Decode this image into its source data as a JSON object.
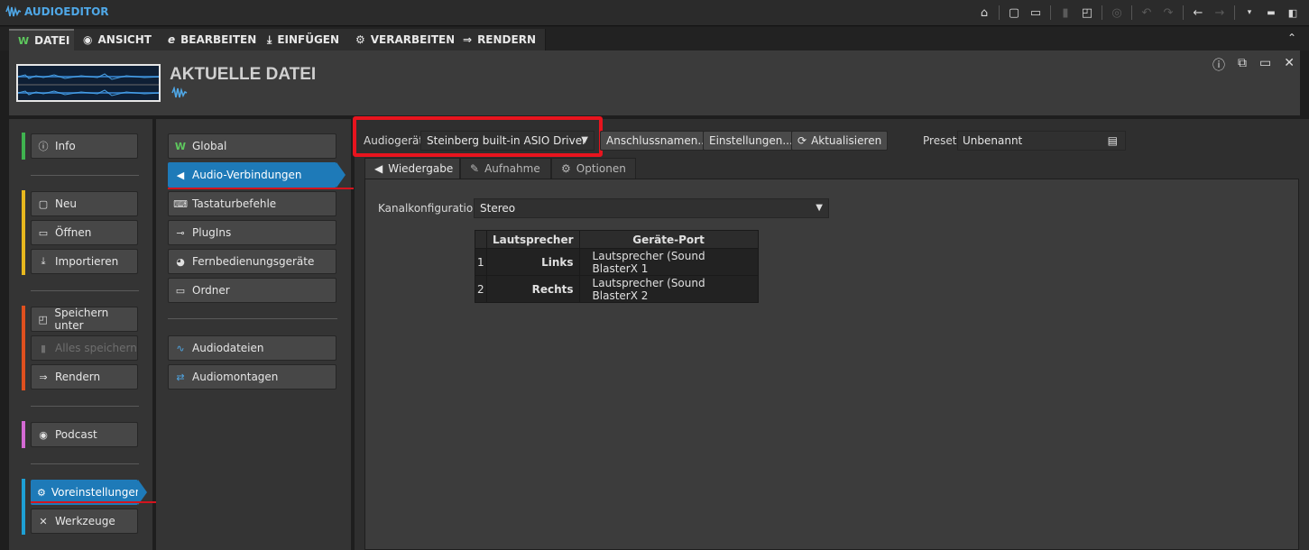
{
  "app": {
    "title": "AUDIOEDITOR"
  },
  "menu": {
    "tabs": [
      {
        "label": "DATEI",
        "icon": "w-logo-icon"
      },
      {
        "label": "ANSICHT",
        "icon": "eye-icon"
      },
      {
        "label": "BEARBEITEN",
        "icon": "edit-icon"
      },
      {
        "label": "EINFÜGEN",
        "icon": "insert-icon"
      },
      {
        "label": "VERARBEITEN",
        "icon": "process-icon"
      },
      {
        "label": "RENDERN",
        "icon": "render-icon"
      }
    ]
  },
  "header": {
    "title": "AKTUELLE DATEI"
  },
  "left_nav": {
    "items": [
      {
        "label": "Info",
        "icon": "info-icon"
      },
      {
        "label": "Neu",
        "icon": "new-file-icon"
      },
      {
        "label": "Öffnen",
        "icon": "folder-open-icon"
      },
      {
        "label": "Importieren",
        "icon": "import-icon"
      },
      {
        "label": "Speichern unter",
        "icon": "save-as-icon"
      },
      {
        "label": "Alles speichern",
        "icon": "save-all-icon",
        "disabled": true
      },
      {
        "label": "Rendern",
        "icon": "render-icon"
      },
      {
        "label": "Podcast",
        "icon": "podcast-icon"
      },
      {
        "label": "Voreinstellungen",
        "icon": "gear-icon",
        "selected": true
      },
      {
        "label": "Werkzeuge",
        "icon": "tools-icon"
      }
    ]
  },
  "prefs_nav": {
    "items": [
      {
        "label": "Global",
        "icon": "w-logo-icon"
      },
      {
        "label": "Audio-Verbindungen",
        "icon": "speaker-icon",
        "selected": true
      },
      {
        "label": "Tastaturbefehle",
        "icon": "keyboard-icon"
      },
      {
        "label": "PlugIns",
        "icon": "plugin-icon"
      },
      {
        "label": "Fernbedienungsgeräte",
        "icon": "remote-icon"
      },
      {
        "label": "Ordner",
        "icon": "folder-icon"
      },
      {
        "label": "Audiodateien",
        "icon": "waveform-icon"
      },
      {
        "label": "Audiomontagen",
        "icon": "montage-icon"
      }
    ]
  },
  "toolbar": {
    "audio_device_label": "Audiogerät",
    "audio_device_value": "Steinberg built-in ASIO Driver",
    "port_names_button": "Anschlussnamen...",
    "settings_button": "Einstellungen...",
    "refresh_button": "Aktualisieren",
    "preset_label": "Preset",
    "preset_value": "Unbenannt"
  },
  "subtabs": [
    {
      "label": "Wiedergabe",
      "icon": "speaker-icon",
      "active": true
    },
    {
      "label": "Aufnahme",
      "icon": "microphone-icon"
    },
    {
      "label": "Optionen",
      "icon": "gear-icon"
    }
  ],
  "playback": {
    "channel_config_label": "Kanalkonfiguration",
    "channel_config_value": "Stereo",
    "table": {
      "headers": [
        "Lautsprecher",
        "Geräte-Port"
      ],
      "rows": [
        {
          "num": "1",
          "speaker": "Links",
          "port": "Lautsprecher (Sound BlasterX 1"
        },
        {
          "num": "2",
          "speaker": "Rechts",
          "port": "Lautsprecher (Sound BlasterX 2"
        }
      ]
    }
  },
  "colors": {
    "accent_blue": "#1e7ab8",
    "highlight_red": "#e8141e",
    "group_green": "#3fb34f",
    "group_yellow": "#e8b81e",
    "group_orange": "#e0501e",
    "group_pink": "#d46ad4",
    "group_cyan": "#1ea0d4"
  }
}
